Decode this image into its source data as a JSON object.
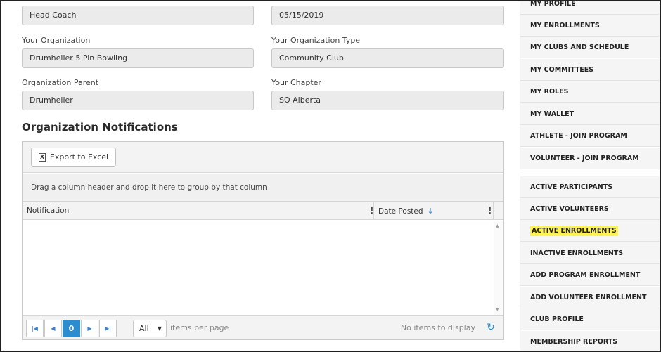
{
  "profile": {
    "role_value": "Head Coach",
    "date_value": "05/15/2019",
    "organization_label": "Your Organization",
    "organization_value": "Drumheller 5 Pin Bowling",
    "organization_type_label": "Your Organization Type",
    "organization_type_value": "Community Club",
    "organization_parent_label": "Organization Parent",
    "organization_parent_value": "Drumheller",
    "chapter_label": "Your Chapter",
    "chapter_value": "SO Alberta"
  },
  "notifications": {
    "title": "Organization Notifications",
    "export_label": "Export to Excel",
    "group_hint": "Drag a column header and drop it here to group by that column",
    "columns": [
      "Notification",
      "Date Posted"
    ],
    "pager": {
      "current_page": "0",
      "page_size": "All",
      "items_per_page_label": "items per page",
      "no_items_label": "No items to display"
    }
  },
  "sidebar": {
    "items": [
      {
        "label": "MY PROFILE"
      },
      {
        "label": "MY ENROLLMENTS"
      },
      {
        "label": "MY CLUBS AND SCHEDULE"
      },
      {
        "label": "MY COMMITTEES"
      },
      {
        "label": "MY ROLES"
      },
      {
        "label": "MY WALLET"
      },
      {
        "label": "ATHLETE - JOIN PROGRAM"
      },
      {
        "label": "VOLUNTEER - JOIN PROGRAM"
      },
      {
        "label": "ACTIVE PARTICIPANTS"
      },
      {
        "label": "ACTIVE VOLUNTEERS"
      },
      {
        "label": "ACTIVE ENROLLMENTS"
      },
      {
        "label": "INACTIVE ENROLLMENTS"
      },
      {
        "label": "ADD PROGRAM ENROLLMENT"
      },
      {
        "label": "ADD VOLUNTEER ENROLLMENT"
      },
      {
        "label": "CLUB PROFILE"
      },
      {
        "label": "MEMBERSHIP REPORTS"
      }
    ]
  },
  "colors": {
    "highlight": "#fff34d",
    "accent": "#2b8ccf"
  }
}
